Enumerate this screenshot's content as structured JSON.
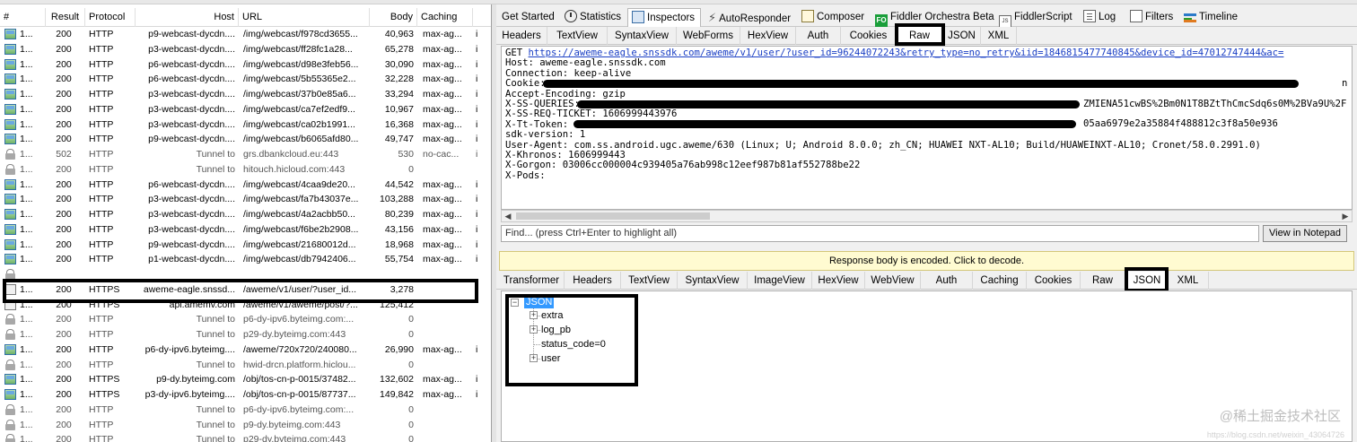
{
  "session_list": {
    "columns": [
      "#",
      "Result",
      "Protocol",
      "Host",
      "URL",
      "Body",
      "Caching"
    ],
    "rows": [
      {
        "icon": "image-icon",
        "num": "1...",
        "result": "200",
        "protocol": "HTTP",
        "host": "p9-webcast-dycdn....",
        "url": "/img/webcast/f978cd3655...",
        "body": "40,963",
        "caching": "max-ag...",
        "extra": "i"
      },
      {
        "icon": "image-icon",
        "num": "1...",
        "result": "200",
        "protocol": "HTTP",
        "host": "p3-webcast-dycdn....",
        "url": "/img/webcast/ff28fc1a28...",
        "body": "65,278",
        "caching": "max-ag...",
        "extra": "i"
      },
      {
        "icon": "image-icon",
        "num": "1...",
        "result": "200",
        "protocol": "HTTP",
        "host": "p6-webcast-dycdn....",
        "url": "/img/webcast/d98e3feb56...",
        "body": "30,090",
        "caching": "max-ag...",
        "extra": "i"
      },
      {
        "icon": "image-icon",
        "num": "1...",
        "result": "200",
        "protocol": "HTTP",
        "host": "p6-webcast-dycdn....",
        "url": "/img/webcast/5b55365e2...",
        "body": "32,228",
        "caching": "max-ag...",
        "extra": "i"
      },
      {
        "icon": "image-icon",
        "num": "1...",
        "result": "200",
        "protocol": "HTTP",
        "host": "p3-webcast-dycdn....",
        "url": "/img/webcast/37b0e85a6...",
        "body": "33,294",
        "caching": "max-ag...",
        "extra": "i"
      },
      {
        "icon": "image-icon",
        "num": "1...",
        "result": "200",
        "protocol": "HTTP",
        "host": "p3-webcast-dycdn....",
        "url": "/img/webcast/ca7ef2edf9...",
        "body": "10,967",
        "caching": "max-ag...",
        "extra": "i"
      },
      {
        "icon": "image-icon",
        "num": "1...",
        "result": "200",
        "protocol": "HTTP",
        "host": "p3-webcast-dycdn....",
        "url": "/img/webcast/ca02b1991...",
        "body": "16,368",
        "caching": "max-ag...",
        "extra": "i"
      },
      {
        "icon": "image-icon",
        "num": "1...",
        "result": "200",
        "protocol": "HTTP",
        "host": "p9-webcast-dycdn....",
        "url": "/img/webcast/b6065afd80...",
        "body": "49,747",
        "caching": "max-ag...",
        "extra": "i"
      },
      {
        "icon": "lock-icon",
        "num": "1...",
        "result": "502",
        "protocol": "HTTP",
        "host": "Tunnel to",
        "url": "grs.dbankcloud.eu:443",
        "body": "530",
        "caching": "no-cac...",
        "extra": "i",
        "gray": true
      },
      {
        "icon": "lock-icon",
        "num": "1...",
        "result": "200",
        "protocol": "HTTP",
        "host": "Tunnel to",
        "url": "hitouch.hicloud.com:443",
        "body": "0",
        "caching": "",
        "extra": "",
        "gray": true
      },
      {
        "icon": "image-icon",
        "num": "1...",
        "result": "200",
        "protocol": "HTTP",
        "host": "p6-webcast-dycdn....",
        "url": "/img/webcast/4caa9de20...",
        "body": "44,542",
        "caching": "max-ag...",
        "extra": "i"
      },
      {
        "icon": "image-icon",
        "num": "1...",
        "result": "200",
        "protocol": "HTTP",
        "host": "p3-webcast-dycdn....",
        "url": "/img/webcast/fa7b43037e...",
        "body": "103,288",
        "caching": "max-ag...",
        "extra": "i"
      },
      {
        "icon": "image-icon",
        "num": "1...",
        "result": "200",
        "protocol": "HTTP",
        "host": "p3-webcast-dycdn....",
        "url": "/img/webcast/4a2acbb50...",
        "body": "80,239",
        "caching": "max-ag...",
        "extra": "i"
      },
      {
        "icon": "image-icon",
        "num": "1...",
        "result": "200",
        "protocol": "HTTP",
        "host": "p3-webcast-dycdn....",
        "url": "/img/webcast/f6be2b2908...",
        "body": "43,156",
        "caching": "max-ag...",
        "extra": "i"
      },
      {
        "icon": "image-icon",
        "num": "1...",
        "result": "200",
        "protocol": "HTTP",
        "host": "p9-webcast-dycdn....",
        "url": "/img/webcast/21680012d...",
        "body": "18,968",
        "caching": "max-ag...",
        "extra": "i"
      },
      {
        "icon": "image-icon",
        "num": "1...",
        "result": "200",
        "protocol": "HTTP",
        "host": "p1-webcast-dycdn....",
        "url": "/img/webcast/db7942406...",
        "body": "55,754",
        "caching": "max-ag...",
        "extra": "i"
      },
      {
        "icon": "lock-icon",
        "num": "",
        "result": "",
        "protocol": "",
        "host": "",
        "url": "",
        "body": "",
        "caching": "",
        "extra": "",
        "gray": true
      },
      {
        "icon": "doc-icon",
        "num": "1...",
        "result": "200",
        "protocol": "HTTPS",
        "host": "aweme-eagle.snssd...",
        "url": "/aweme/v1/user/?user_id...",
        "body": "3,278",
        "caching": "",
        "extra": ""
      },
      {
        "icon": "doc-icon",
        "num": "1...",
        "result": "200",
        "protocol": "HTTPS",
        "host": "api.amemv.com",
        "url": "/aweme/v1/aweme/post/?...",
        "body": "125,412",
        "caching": "",
        "extra": ""
      },
      {
        "icon": "lock-icon",
        "num": "1...",
        "result": "200",
        "protocol": "HTTP",
        "host": "Tunnel to",
        "url": "p6-dy-ipv6.byteimg.com:...",
        "body": "0",
        "caching": "",
        "extra": "",
        "gray": true
      },
      {
        "icon": "lock-icon",
        "num": "1...",
        "result": "200",
        "protocol": "HTTP",
        "host": "Tunnel to",
        "url": "p29-dy.byteimg.com:443",
        "body": "0",
        "caching": "",
        "extra": "",
        "gray": true
      },
      {
        "icon": "image-icon",
        "num": "1...",
        "result": "200",
        "protocol": "HTTP",
        "host": "p6-dy-ipv6.byteimg....",
        "url": "/aweme/720x720/240080...",
        "body": "26,990",
        "caching": "max-ag...",
        "extra": "i"
      },
      {
        "icon": "lock-icon",
        "num": "1...",
        "result": "200",
        "protocol": "HTTP",
        "host": "Tunnel to",
        "url": "hwid-drcn.platform.hiclou...",
        "body": "0",
        "caching": "",
        "extra": "",
        "gray": true
      },
      {
        "icon": "image-icon",
        "num": "1...",
        "result": "200",
        "protocol": "HTTPS",
        "host": "p9-dy.byteimg.com",
        "url": "/obj/tos-cn-p-0015/37482...",
        "body": "132,602",
        "caching": "max-ag...",
        "extra": "i"
      },
      {
        "icon": "image-icon",
        "num": "1...",
        "result": "200",
        "protocol": "HTTPS",
        "host": "p3-dy-ipv6.byteimg....",
        "url": "/obj/tos-cn-p-0015/87737...",
        "body": "149,842",
        "caching": "max-ag...",
        "extra": "i"
      },
      {
        "icon": "lock-icon",
        "num": "1...",
        "result": "200",
        "protocol": "HTTP",
        "host": "Tunnel to",
        "url": "p6-dy-ipv6.byteimg.com:...",
        "body": "0",
        "caching": "",
        "extra": "",
        "gray": true
      },
      {
        "icon": "lock-icon",
        "num": "1...",
        "result": "200",
        "protocol": "HTTP",
        "host": "Tunnel to",
        "url": "p9-dy.byteimg.com:443",
        "body": "0",
        "caching": "",
        "extra": "",
        "gray": true
      },
      {
        "icon": "lock-icon",
        "num": "1...",
        "result": "200",
        "protocol": "HTTP",
        "host": "Tunnel to",
        "url": "p29-dy.byteimg.com:443",
        "body": "0",
        "caching": "",
        "extra": "",
        "gray": true
      }
    ]
  },
  "main_tabs": [
    {
      "label": "Get Started",
      "icon": ""
    },
    {
      "label": "Statistics",
      "icon": "clock-icon"
    },
    {
      "label": "Inspectors",
      "icon": "inspectors-icon",
      "active": true
    },
    {
      "label": "AutoResponder",
      "icon": "lightning-icon"
    },
    {
      "label": "Composer",
      "icon": "composer-icon"
    },
    {
      "label": "Fiddler Orchestra Beta",
      "icon": "fo-icon",
      "icon_text": "FO"
    },
    {
      "label": "FiddlerScript",
      "icon": "js-icon",
      "icon_text": "JS"
    },
    {
      "label": "Log",
      "icon": "log-icon"
    },
    {
      "label": "Filters",
      "icon": "checkbox-icon"
    },
    {
      "label": "Timeline",
      "icon": "timeline-icon"
    }
  ],
  "request_tabs": [
    "Headers",
    "TextView",
    "SyntaxView",
    "WebForms",
    "HexView",
    "Auth",
    "Cookies",
    "Raw",
    "JSON",
    "XML"
  ],
  "request_active_tab": "Raw",
  "raw_request": {
    "method": "GET ",
    "url": "https://aweme-eagle.snssdk.com/aweme/v1/user/?user_id=96244072243&retry_type=no_retry&iid=1846815477740845&device_id=47012747444&ac=",
    "lines_after_url": [
      "Host: aweme-eagle.snssdk.com",
      "Connection: keep-alive",
      "Cookie: ",
      "Accept-Encoding: gzip",
      "X-SS-QUERIES: ",
      "X-SS-REQ-TICKET: 1606999443976",
      "X-Tt-Token: ",
      "sdk-version: 1",
      "User-Agent: com.ss.android.ugc.aweme/630 (Linux; U; Android 8.0.0; zh_CN; HUAWEI NXT-AL10; Build/HUAWEINXT-AL10; Cronet/58.0.2991.0)",
      "X-Khronos: 1606999443",
      "X-Gorgon: 03006cc000004c939405a76ab998c12eef987b81af552788be22",
      "X-Pods: "
    ],
    "cookie_tail": "n",
    "queries_tail": "ZMIENA51cwBS%2Bm0N1T8BZtThCmcSdq6s0M%2BVa9U%2F",
    "token_tail": "05aa6979e2a35884f488812c3f8a50e936"
  },
  "find_bar": {
    "placeholder": "Find... (press Ctrl+Enter to highlight all)"
  },
  "view_notepad_label": "View in Notepad",
  "encoded_notice": "Response body is encoded. Click to decode.",
  "response_tabs": [
    "Transformer",
    "Headers",
    "TextView",
    "SyntaxView",
    "ImageView",
    "HexView",
    "WebView",
    "Auth",
    "Caching",
    "Cookies",
    "Raw",
    "JSON",
    "XML"
  ],
  "response_active_tab": "JSON",
  "json_tree": {
    "root": "JSON",
    "children": [
      {
        "label": "extra",
        "expandable": true
      },
      {
        "label": "log_pb",
        "expandable": true
      },
      {
        "label": "status_code=0",
        "expandable": false
      },
      {
        "label": "user",
        "expandable": true
      }
    ]
  },
  "watermark": "@稀土掘金技术社区",
  "watermark_sub": "https://blog.csdn.net/weixin_43064726"
}
